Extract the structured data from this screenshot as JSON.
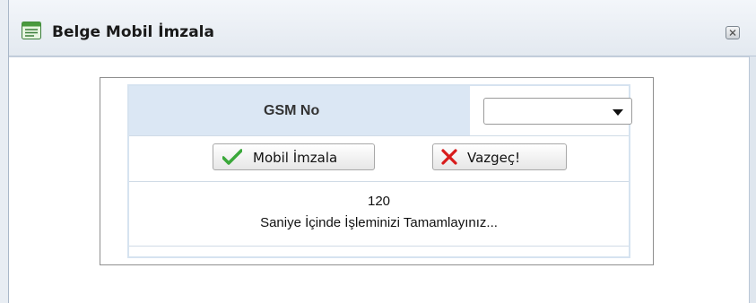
{
  "window": {
    "title": "Belge Mobil İmzala",
    "title_icon": "form-window-icon",
    "close_icon": "close-icon"
  },
  "form": {
    "gsm_label": "GSM No",
    "gsm_select_value": "",
    "sign_button_label": "Mobil İmzala",
    "sign_button_icon": "checkmark-icon",
    "cancel_button_label": "Vazgeç!",
    "cancel_button_icon": "x-icon",
    "countdown": "120",
    "countdown_message": "Saniye İçinde İşleminizi Tamamlayınız..."
  },
  "colors": {
    "label_cell_bg": "#dbe7f4",
    "check_green": "#3aa83a",
    "cancel_red": "#d81b1b"
  }
}
